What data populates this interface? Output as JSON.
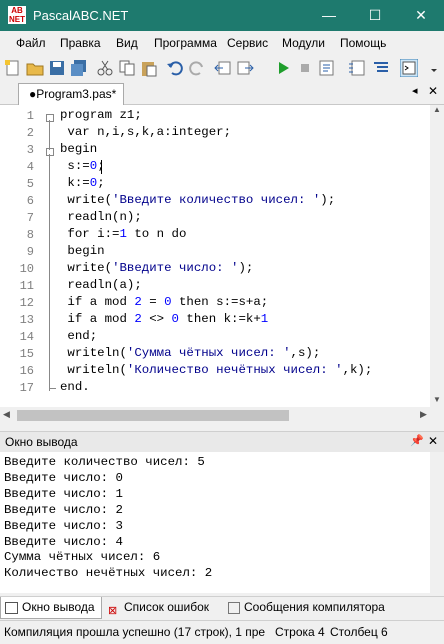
{
  "window": {
    "title": "PascalABC.NET",
    "icon_text": "AB NET",
    "minimize": "—",
    "maximize": "☐",
    "close": "✕"
  },
  "menu": [
    "Файл",
    "Правка",
    "Вид",
    "Программа",
    "Сервис",
    "Модули",
    "Помощь"
  ],
  "tab": {
    "label": "●Program3.pas*",
    "close": "✕"
  },
  "editor": {
    "line_numbers": [
      "1",
      "2",
      "3",
      "4",
      "5",
      "6",
      "7",
      "8",
      "9",
      "10",
      "11",
      "12",
      "13",
      "14",
      "15",
      "16",
      "17"
    ],
    "lines": [
      "program z1;",
      " var n,i,s,k,a:integer;",
      "begin",
      " s:=0;",
      " k:=0;",
      " write('Введите количество чисел: ');",
      " readln(n);",
      " for i:=1 to n do",
      " begin",
      " write('Введите число: ');",
      " readln(a);",
      " if a mod 2 = 0 then s:=s+a;",
      " if a mod 2 <> 0 then k:=k+1",
      " end;",
      " writeln('Сумма чётных чисел: ',s);",
      " writeln('Количество нечётных чисел: ',k);",
      "end."
    ]
  },
  "output_panel": {
    "title": "Окно вывода",
    "pin": "📌",
    "close": "✕",
    "lines": [
      "Введите количество чисел: 5",
      "Введите число: 0",
      "Введите число: 1",
      "Введите число: 2",
      "Введите число: 3",
      "Введите число: 4",
      "Сумма чётных чисел: 6",
      "Количество нечётных чисел: 2"
    ]
  },
  "bottom_tabs": [
    "Окно вывода",
    "Список ошибок",
    "Сообщения компилятора"
  ],
  "status": {
    "message": "Компиляция прошла успешно (17 строк), 1 пре",
    "line": "Строка  4",
    "column": "Столбец  6"
  },
  "colors": {
    "titlebar": "#1e7a6e",
    "keyword": "#000000",
    "string": "#00008b",
    "number": "#0000ff"
  }
}
